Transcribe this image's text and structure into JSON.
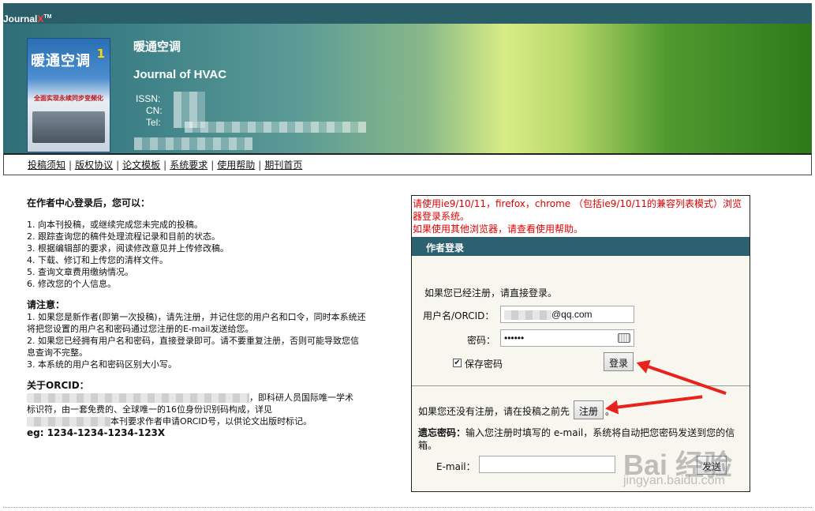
{
  "header": {
    "logo": "Journal",
    "logo_x": "X",
    "logo_tm": "TM",
    "journal_cn": "暖通空调",
    "journal_en": "Journal of HVAC",
    "issn_label": "ISSN:",
    "cn_label": "CN:",
    "tel_label": "Tel:",
    "cover_title": "暖通空调",
    "cover_issue": "1",
    "cover_subtitle": "全面实现永续同步变频化"
  },
  "nav": {
    "items": [
      "投稿须知",
      "版权协议",
      "论文模板",
      "系统要求",
      "使用帮助",
      "期刊首页"
    ],
    "separator": "|"
  },
  "left": {
    "heading": "在作者中心登录后，您可以：",
    "features": [
      "1. 向本刊投稿，或继续完成您未完成的投稿。",
      "2. 跟踪查询您的稿件处理流程记录和目前的状态。",
      "3. 根据编辑部的要求，阅读修改意见并上传修改稿。",
      "4. 下载、修订和上传您的清样文件。",
      "5. 查询文章费用缴纳情况。",
      "6. 修改您的个人信息。"
    ],
    "notice_heading": "请注意：",
    "notices": [
      "1. 如果您是新作者(即第一次投稿)，请先注册，并记住您的用户名和口令，同时本系统还将把您设置的用户名和密码通过您注册的E-mail发送给您。",
      "2. 如果您已经拥有用户名和密码，直接登录即可。请不要重复注册，否则可能导致您信息查询不完整。",
      "3. 本系统的用户名和密码区别大小写。"
    ],
    "orcid_heading": "关于ORCID：",
    "orcid_text_1": "，即科研人员国际唯一学术",
    "orcid_text_2": "标识符，由一套免费的、全球唯一的16位身份识别码构成，详见",
    "orcid_text_3": "本刊要求作者申请ORCID号，以供论文出版时标记。",
    "orcid_example": "eg: 1234-1234-1234-123X"
  },
  "panel": {
    "browser_notice_1": "请使用ie9/10/11，firefox，chrome （包括ie9/10/11的兼容列表模式）浏览器登录系统。",
    "browser_notice_2": "如果使用其他浏览器，请查看使用帮助。",
    "login_title": "作者登录",
    "registered_hint": "如果您已经注册，请直接登录。",
    "username_label": "用户名/ORCID：",
    "username_value": "@qq.com",
    "password_label": "密码：",
    "password_value": "••••••",
    "remember_label": "保存密码",
    "remember_check": "✔",
    "login_button": "登录",
    "register_hint": "如果您还没有注册，请在投稿之前先",
    "register_button": "注册",
    "register_period": "。",
    "forgot_label": "遗忘密码：",
    "forgot_text": "输入您注册时填写的 e-mail，系统将自动把您密码发送到您的信箱。",
    "email_label": "E-mail：",
    "email_value": "",
    "send_button": "发送"
  },
  "watermark": {
    "brand": "Bai 经验",
    "url": "jingyan.baidu.com"
  },
  "colors": {
    "notice_red": "#e00000",
    "login_header": "#2d6070",
    "arrow_red": "#e8231c"
  }
}
